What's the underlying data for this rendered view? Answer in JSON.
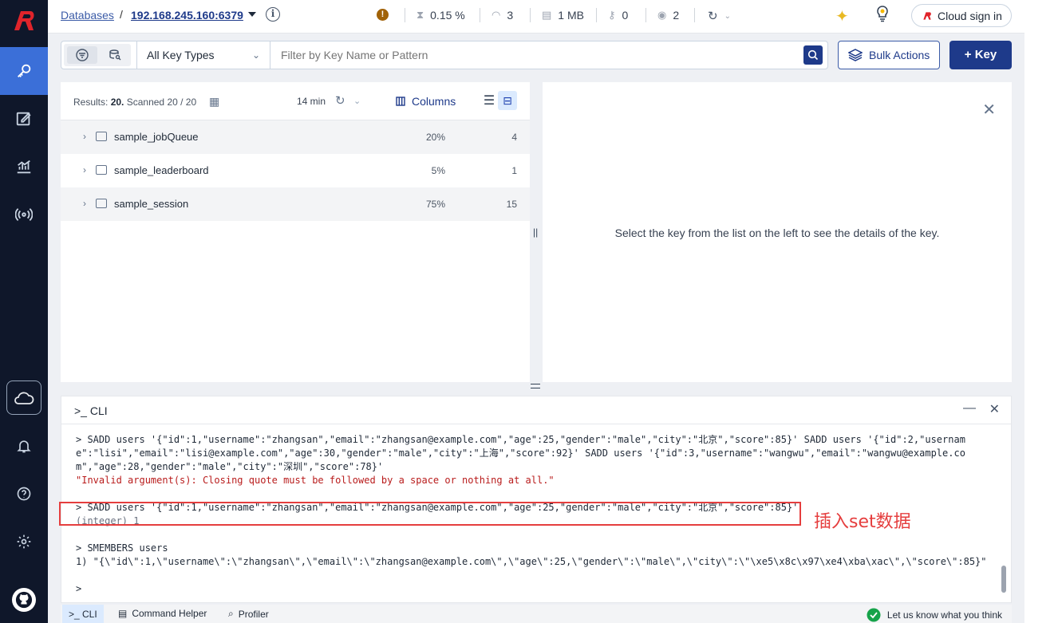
{
  "nav": {
    "items": [
      "browser",
      "workbench",
      "analytics",
      "pubsub"
    ],
    "bottom": [
      "cloud",
      "notifications",
      "help",
      "settings",
      "github"
    ]
  },
  "topbar": {
    "databases": "Databases",
    "separator": "/",
    "host": "192.168.245.160:6379",
    "cpu": "0.15 %",
    "commands": "3",
    "memory": "1 MB",
    "keys": "0",
    "clients": "2",
    "cloud_sign_in": "Cloud sign in"
  },
  "filter": {
    "type_label": "All Key Types",
    "placeholder": "Filter by Key Name or Pattern",
    "bulk_actions": "Bulk Actions",
    "add_key": "+ Key"
  },
  "list": {
    "results_label": "Results:",
    "results_value": "20.",
    "scanned": "Scanned 20 / 20",
    "last_refresh": "14 min",
    "columns": "Columns",
    "rows": [
      {
        "name": "sample_jobQueue",
        "pct": "20%",
        "count": "4"
      },
      {
        "name": "sample_leaderboard",
        "pct": "5%",
        "count": "1"
      },
      {
        "name": "sample_session",
        "pct": "75%",
        "count": "15"
      }
    ]
  },
  "details": {
    "empty_message": "Select the key from the list on the left to see the details of the key."
  },
  "cli": {
    "title": ">_ CLI",
    "line1": "> SADD users '{\"id\":1,\"username\":\"zhangsan\",\"email\":\"zhangsan@example.com\",\"age\":25,\"gender\":\"male\",\"city\":\"北京\",\"score\":85}' SADD users '{\"id\":2,\"username\":\"lisi\",\"email\":\"lisi@example.com\",\"age\":30,\"gender\":\"male\",\"city\":\"上海\",\"score\":92}' SADD users '{\"id\":3,\"username\":\"wangwu\",\"email\":\"wangwu@example.com\",\"age\":28,\"gender\":\"male\",\"city\":\"深圳\",\"score\":78}'",
    "error1": "\"Invalid argument(s): Closing quote must be followed by a space or nothing at all.\"",
    "line2": "> SADD users '{\"id\":1,\"username\":\"zhangsan\",\"email\":\"zhangsan@example.com\",\"age\":25,\"gender\":\"male\",\"city\":\"北京\",\"score\":85}'",
    "result2": "(integer) 1",
    "line3": "> SMEMBERS users",
    "result3": "1) \"{\\\"id\\\":1,\\\"username\\\":\\\"zhangsan\\\",\\\"email\\\":\\\"zhangsan@example.com\\\",\\\"age\\\":25,\\\"gender\\\":\\\"male\\\",\\\"city\\\":\\\"\\xe5\\x8c\\x97\\xe4\\xba\\xac\\\",\\\"score\\\":85}\"",
    "prompt": ">",
    "annotation": "插入set数据"
  },
  "bottom": {
    "cli": ">_ CLI",
    "command_helper": "Command Helper",
    "profiler": "Profiler",
    "feedback": "Let us know what you think"
  }
}
